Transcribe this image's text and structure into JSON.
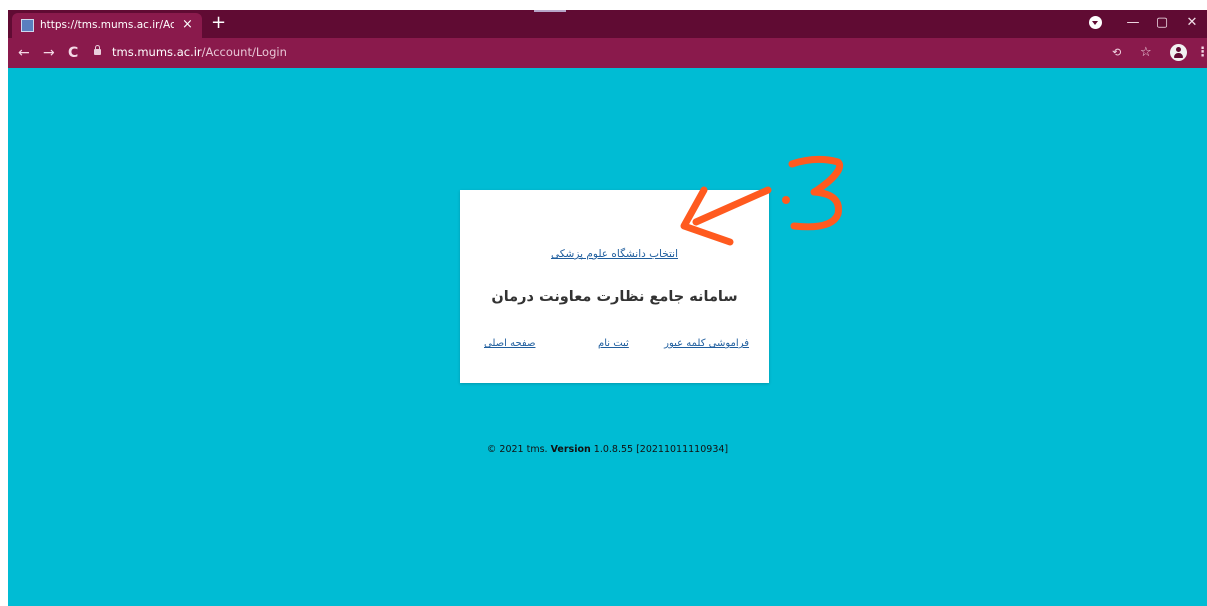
{
  "browser": {
    "tab_title": "https://tms.mums.ac.ir/Account/",
    "tab_close": "×",
    "new_tab": "+",
    "url_host": "tms.mums.ac.ir",
    "url_path": "/Account/Login",
    "back": "←",
    "forward": "→",
    "reload": "C",
    "minimize": "—",
    "maximize": "▢",
    "close": "✕",
    "star": "☆",
    "menu": "⋮",
    "translate": "⟲",
    "theme": {
      "tabbar": "#600b33",
      "navbar": "#8a1a4c"
    }
  },
  "card": {
    "university_link": "انتخاب دانشگاه علوم پزشکی",
    "system_title": "سامانه جامع نظارت معاونت درمان",
    "forgot_password": "فراموشی کلمه عبور",
    "register": "ثبت نام",
    "home": "صفحه اصلی"
  },
  "footer": {
    "prefix": "© 2021 tms.",
    "version_label": "Version",
    "version_value": "1.0.8.55 [20211011110934]"
  },
  "annotation": {
    "step": "3",
    "color": "#ff5a1f",
    "icon": "arrow-pointing-left"
  },
  "page_background": "#00bcd4"
}
